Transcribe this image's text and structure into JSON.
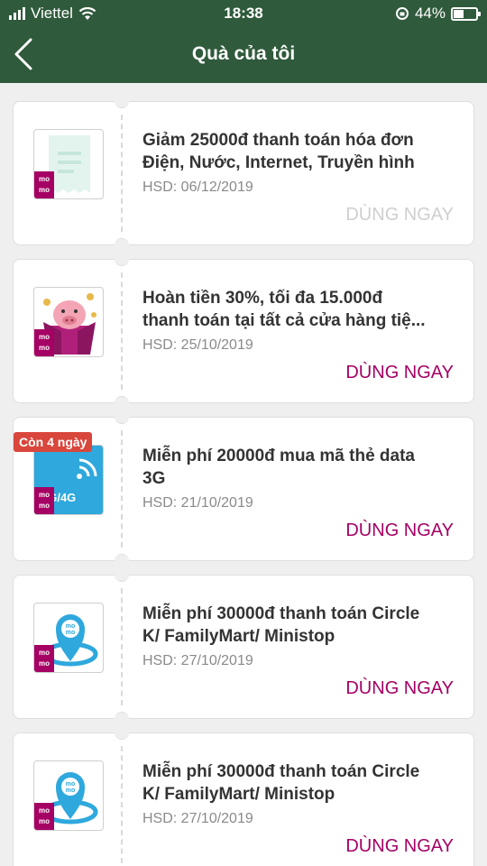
{
  "status_bar": {
    "carrier": "Viettel",
    "time": "18:38",
    "battery": "44%"
  },
  "nav": {
    "title": "Quà của tôi"
  },
  "brand_color": "#a50064",
  "cards": [
    {
      "line1": "Giảm 25000đ thanh toán hóa đơn",
      "line2": "Điện, Nước, Internet, Truyền hình",
      "expiry": "HSD: 06/12/2019",
      "action": "DÙNG NGAY",
      "icon": "receipt-icon",
      "badge_text": "momo"
    },
    {
      "line1": "Hoàn tiền 30%, tối đa 15.000đ",
      "line2": "thanh toán tại tất cả cửa hàng tiệ...",
      "expiry": "HSD: 25/10/2019",
      "action": "DÙNG NGAY",
      "icon": "pig-gift-icon",
      "badge_text": "momo"
    },
    {
      "line1": "Miễn phí 20000đ mua mã thẻ data",
      "line2": "3G",
      "expiry": "HSD: 21/10/2019",
      "action": "DÙNG NGAY",
      "icon": "data-3g4g-icon",
      "badge_text": "momo",
      "tag": "Còn 4 ngày",
      "icon_label": "3G/4G"
    },
    {
      "line1": "Miễn phí 30000đ thanh toán Circle",
      "line2": "K/ FamilyMart/ Ministop",
      "expiry": "HSD: 27/10/2019",
      "action": "DÙNG NGAY",
      "icon": "location-pin-icon",
      "badge_text": "momo"
    },
    {
      "line1": "Miễn phí 30000đ thanh toán Circle",
      "line2": "K/ FamilyMart/ Ministop",
      "expiry": "HSD: 27/10/2019",
      "action": "DÙNG NGAY",
      "icon": "location-pin-icon",
      "badge_text": "momo"
    }
  ]
}
